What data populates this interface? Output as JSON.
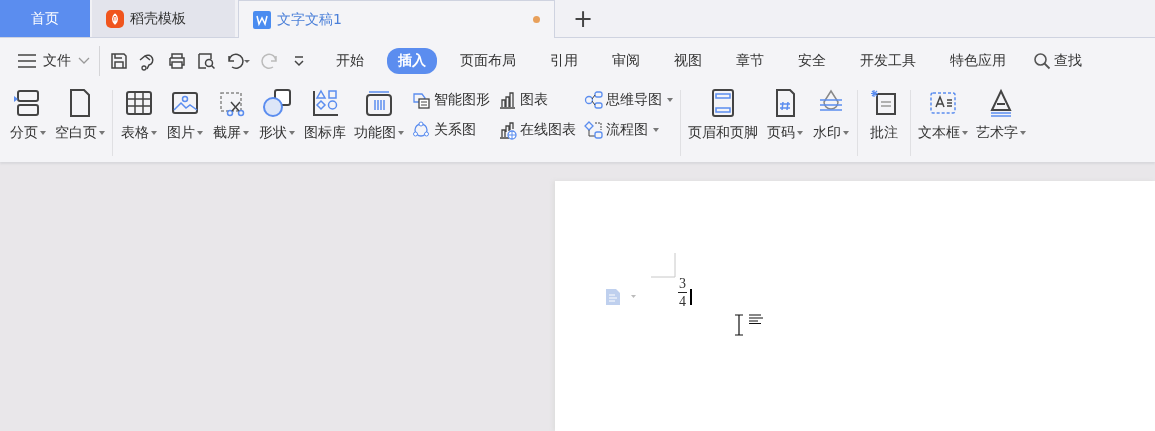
{
  "title_tabs": [
    {
      "kind": "home",
      "label": "首页",
      "selected": false
    },
    {
      "kind": "template",
      "label": "稻壳模板",
      "selected": false
    },
    {
      "kind": "document",
      "label": "文字文稿1",
      "selected": true,
      "unsaved": true
    }
  ],
  "new_tab": "+",
  "file_menu": "文件",
  "menu_tabs": [
    {
      "label": "开始",
      "selected": false
    },
    {
      "label": "插入",
      "selected": true
    },
    {
      "label": "页面布局",
      "selected": false
    },
    {
      "label": "引用",
      "selected": false
    },
    {
      "label": "审阅",
      "selected": false
    },
    {
      "label": "视图",
      "selected": false
    },
    {
      "label": "章节",
      "selected": false
    },
    {
      "label": "安全",
      "selected": false
    },
    {
      "label": "开发工具",
      "selected": false
    },
    {
      "label": "特色应用",
      "selected": false
    }
  ],
  "search": "查找",
  "ribbon_groups": [
    {
      "items": [
        {
          "kind": "large",
          "label": "分页",
          "dropdown": true
        },
        {
          "kind": "large",
          "label": "空白页",
          "dropdown": true
        }
      ]
    },
    {
      "items": [
        {
          "kind": "large",
          "label": "表格",
          "dropdown": true
        },
        {
          "kind": "large",
          "label": "图片",
          "dropdown": true
        },
        {
          "kind": "large",
          "label": "截屏",
          "dropdown": true
        },
        {
          "kind": "large",
          "label": "形状",
          "dropdown": true
        },
        {
          "kind": "large",
          "label": "图标库",
          "dropdown": false
        },
        {
          "kind": "large",
          "label": "功能图",
          "dropdown": true
        },
        {
          "kind": "stack",
          "rows": [
            {
              "label": "智能图形",
              "dropdown": false
            },
            {
              "label": "关系图",
              "dropdown": false
            }
          ]
        },
        {
          "kind": "stack",
          "rows": [
            {
              "label": "图表",
              "dropdown": false
            },
            {
              "label": "在线图表",
              "dropdown": false
            }
          ]
        },
        {
          "kind": "stack",
          "rows": [
            {
              "label": "思维导图",
              "dropdown": true
            },
            {
              "label": "流程图",
              "dropdown": true
            }
          ]
        }
      ]
    },
    {
      "items": [
        {
          "kind": "large",
          "label": "页眉和页脚",
          "dropdown": false
        },
        {
          "kind": "large",
          "label": "页码",
          "dropdown": true
        },
        {
          "kind": "large",
          "label": "水印",
          "dropdown": true
        }
      ]
    },
    {
      "items": [
        {
          "kind": "large",
          "label": "批注",
          "dropdown": false
        }
      ]
    },
    {
      "items": [
        {
          "kind": "large",
          "label": "文本框",
          "dropdown": true
        },
        {
          "kind": "large",
          "label": "艺术字",
          "dropdown": true
        }
      ]
    }
  ],
  "document": {
    "fraction": {
      "numerator": "3",
      "denominator": "4"
    }
  }
}
